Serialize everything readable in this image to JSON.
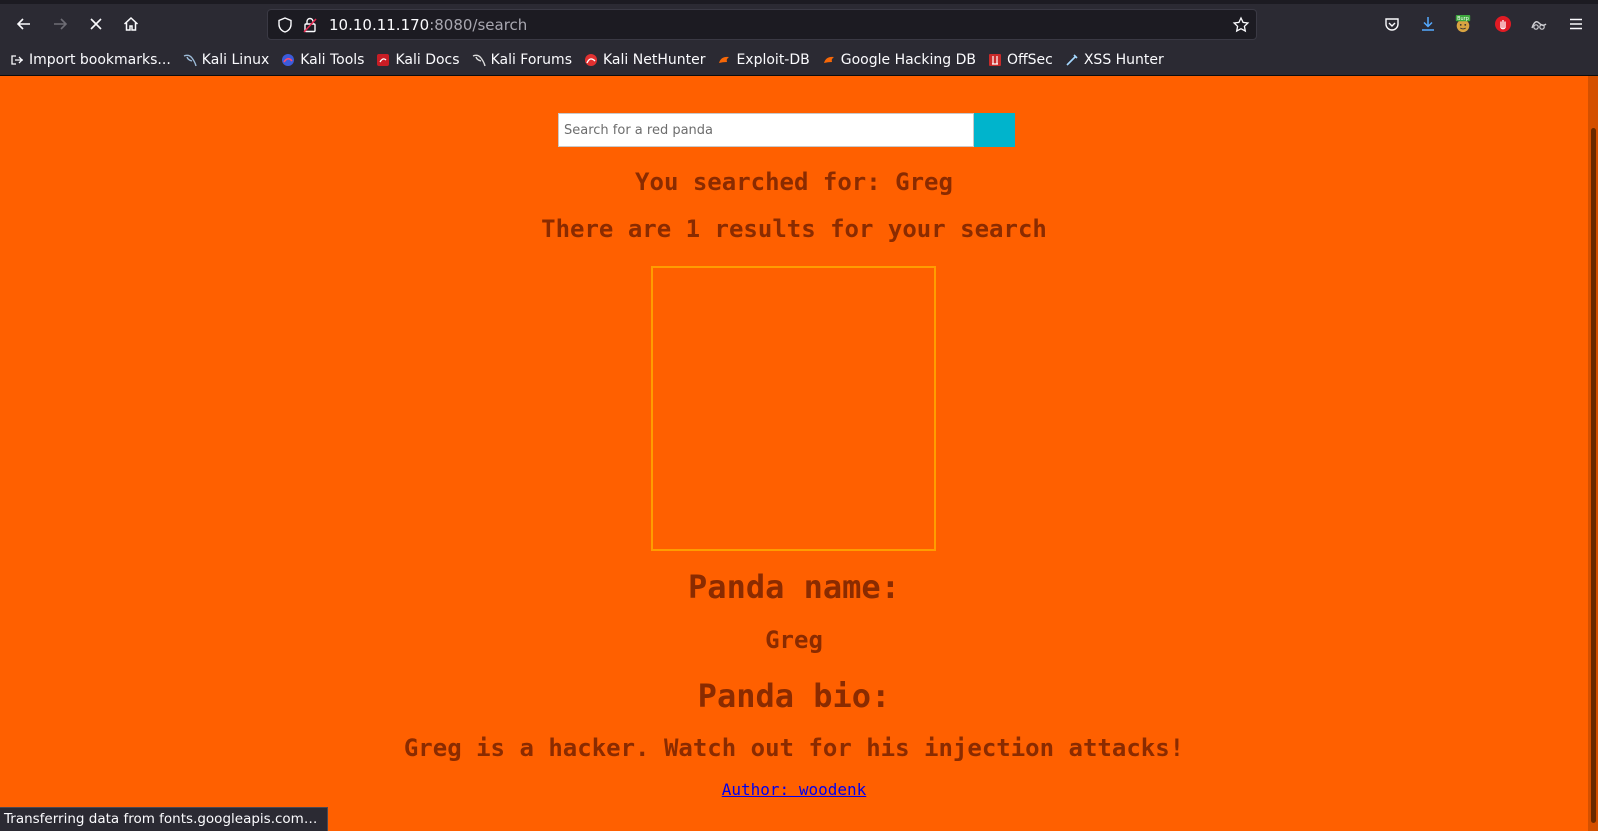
{
  "browser": {
    "url_host": "10.10.11.170",
    "url_rest": ":8080/search",
    "bookmarks": [
      {
        "label": "Import bookmarks...",
        "icon": "import-icon"
      },
      {
        "label": "Kali Linux",
        "icon": "kali-dragon-icon"
      },
      {
        "label": "Kali Tools",
        "icon": "kali-tools-icon"
      },
      {
        "label": "Kali Docs",
        "icon": "kali-docs-icon"
      },
      {
        "label": "Kali Forums",
        "icon": "kali-dragon-icon"
      },
      {
        "label": "Kali NetHunter",
        "icon": "nethunter-icon"
      },
      {
        "label": "Exploit-DB",
        "icon": "exploitdb-icon"
      },
      {
        "label": "Google Hacking DB",
        "icon": "ghdb-icon"
      },
      {
        "label": "OffSec",
        "icon": "offsec-icon"
      },
      {
        "label": "XSS Hunter",
        "icon": "xss-hunter-icon"
      }
    ],
    "burp_badge": "Burp",
    "status_text": "Transferring data from fonts.googleapis.com…"
  },
  "page": {
    "search_placeholder": "Search for a red panda",
    "searched_for": "You searched for: Greg",
    "results_text": "There are 1 results for your search",
    "panda_name_heading": "Panda name:",
    "panda_name": "Greg",
    "panda_bio_heading": "Panda bio:",
    "panda_bio": "Greg is a hacker. Watch out for his injection attacks!",
    "author_link": "Author: woodenk"
  },
  "colors": {
    "page_bg": "#ff6000",
    "text": "#8a2b00",
    "search_button": "#00b4cc",
    "image_border": "#ff9d00"
  }
}
